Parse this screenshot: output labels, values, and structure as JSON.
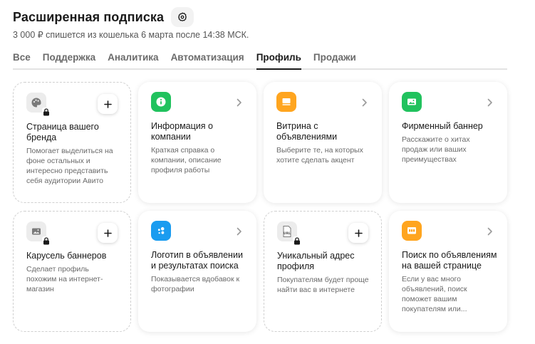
{
  "header": {
    "title": "Расширенная подписка",
    "subtitle": "3 000 ₽ спишется из кошелька 6 марта после 14:38  МСК."
  },
  "tabs": [
    {
      "label": "Все"
    },
    {
      "label": "Поддержка"
    },
    {
      "label": "Аналитика"
    },
    {
      "label": "Автоматизация"
    },
    {
      "label": "Профиль"
    },
    {
      "label": "Продажи"
    }
  ],
  "active_tab": "Профиль",
  "cards": [
    {
      "title": "Страница вашего бренда",
      "description": "Помогает выделиться на фоне остальных и интересно представить себя аудитории Авито",
      "icon": "palette-icon",
      "locked": true,
      "action": "add"
    },
    {
      "title": "Информация о компании",
      "description": "Краткая справка о компании, описание профиля работы",
      "icon": "info-icon",
      "locked": false,
      "action": "open"
    },
    {
      "title": "Витрина с объявлениями",
      "description": "Выберите те, на которых хотите сделать акцент",
      "icon": "showcase-icon",
      "locked": false,
      "action": "open"
    },
    {
      "title": "Фирменный баннер",
      "description": "Расскажите о хитах продаж или ваших преимуществах",
      "icon": "banner-icon",
      "locked": false,
      "action": "open"
    },
    {
      "title": "Карусель баннеров",
      "description": "Сделает профиль похожим на интернет-магазин",
      "icon": "image-carousel-icon",
      "locked": true,
      "action": "add"
    },
    {
      "title": "Логотип в объявлении и результатах поиска",
      "description": "Показывается вдобавок к фотографии",
      "icon": "logo-icon",
      "locked": false,
      "action": "open"
    },
    {
      "title": "Уникальный адрес профиля",
      "description": "Покупателям будет проще найти вас в интернете",
      "icon": "url-icon",
      "locked": true,
      "action": "add"
    },
    {
      "title": "Поиск по объявлениям на вашей странице",
      "description": "Если у вас много объявлений, поиск поможет вашим покупателям или...",
      "icon": "search-page-icon",
      "locked": false,
      "action": "open"
    }
  ],
  "colors": {
    "green": "#21c25e",
    "orange": "#ffa51f",
    "blue": "#1a9cf0",
    "grey_icon": "#ececec"
  }
}
